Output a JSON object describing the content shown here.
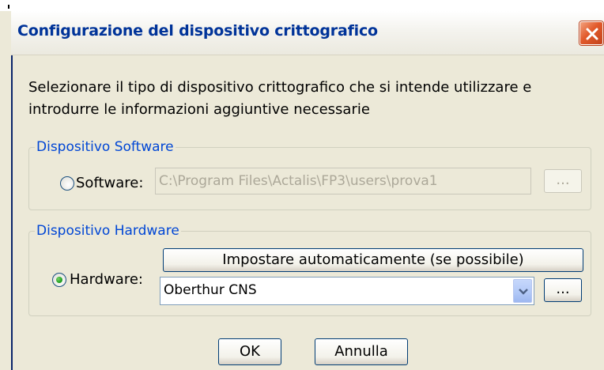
{
  "dialog": {
    "title": "Configurazione del dispositivo crittografico",
    "intro_line1": "Selezionare il tipo di dispositivo crittografico che si intende utilizzare e",
    "intro_line2": "introdurre le informazioni aggiuntive necessarie"
  },
  "software_group": {
    "legend": "Dispositivo Software",
    "radio_label": "Software:",
    "radio_checked": false,
    "path_value": "C:\\Program Files\\Actalis\\FP3\\users\\prova1",
    "browse_label": "..."
  },
  "hardware_group": {
    "legend": "Dispositivo Hardware",
    "auto_button_label": "Impostare automaticamente (se possibile)",
    "radio_label": "Hardware:",
    "radio_checked": true,
    "device_selected": "Oberthur CNS",
    "browse_label": "..."
  },
  "footer": {
    "ok_label": "OK",
    "cancel_label": "Annulla"
  },
  "icons": {
    "close": "close-icon",
    "dropdown": "chevron-down-icon"
  },
  "colors": {
    "title": "#003399",
    "legend": "#0046d5",
    "close_button": "#e25a2b",
    "dialog_background": "#ece9d8"
  }
}
